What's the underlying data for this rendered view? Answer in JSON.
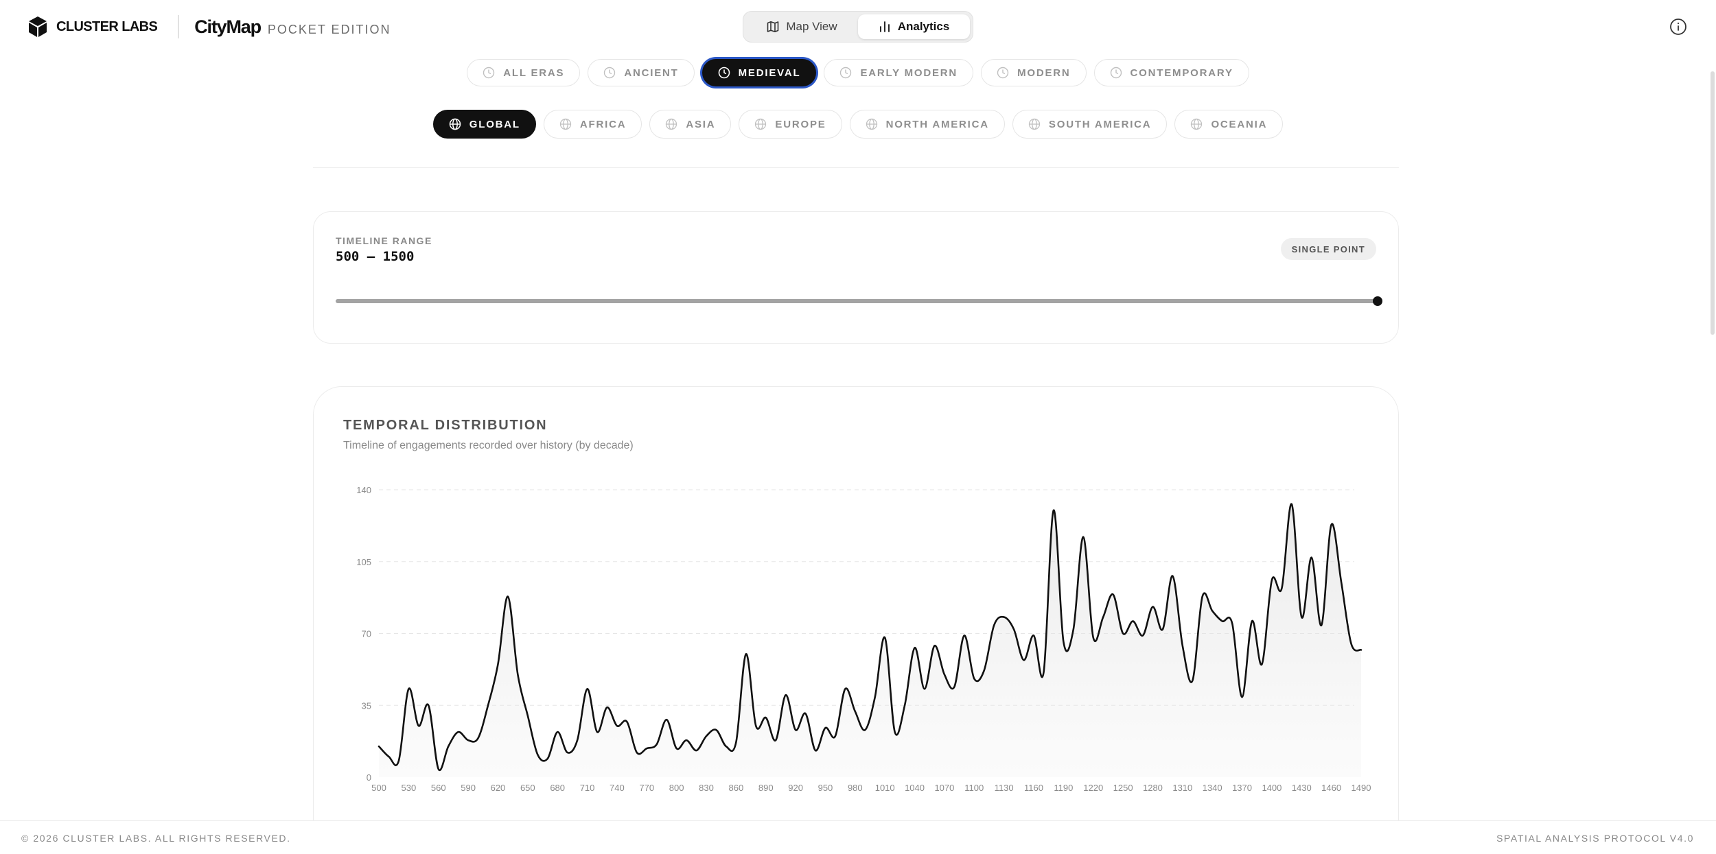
{
  "header": {
    "brand": "CLUSTER LABS",
    "app_name": "CityMap",
    "edition": "POCKET EDITION",
    "views": [
      {
        "label": "Map View",
        "icon": "map-icon",
        "active": false
      },
      {
        "label": "Analytics",
        "icon": "bar-chart-icon",
        "active": true
      }
    ],
    "info_icon": "info-icon"
  },
  "eras": [
    {
      "label": "ALL ERAS",
      "active": false
    },
    {
      "label": "ANCIENT",
      "active": false
    },
    {
      "label": "MEDIEVAL",
      "active": true
    },
    {
      "label": "EARLY MODERN",
      "active": false
    },
    {
      "label": "MODERN",
      "active": false
    },
    {
      "label": "CONTEMPORARY",
      "active": false
    }
  ],
  "regions": [
    {
      "label": "GLOBAL",
      "active": true
    },
    {
      "label": "AFRICA",
      "active": false
    },
    {
      "label": "ASIA",
      "active": false
    },
    {
      "label": "EUROPE",
      "active": false
    },
    {
      "label": "NORTH AMERICA",
      "active": false
    },
    {
      "label": "SOUTH AMERICA",
      "active": false
    },
    {
      "label": "OCEANIA",
      "active": false
    }
  ],
  "timeline": {
    "label": "TIMELINE RANGE",
    "value": "500 — 1500",
    "mode": "SINGLE POINT",
    "min": 500,
    "max": 1500,
    "selected": 1500
  },
  "chart": {
    "title": "TEMPORAL DISTRIBUTION",
    "subtitle": "Timeline of engagements recorded over history (by decade)"
  },
  "chart_data": {
    "type": "area",
    "title": "TEMPORAL DISTRIBUTION",
    "subtitle": "Timeline of engagements recorded over history (by decade)",
    "xlabel": "",
    "ylabel": "",
    "xlim": [
      500,
      1490
    ],
    "ylim": [
      0,
      140
    ],
    "yticks": [
      0,
      35,
      70,
      105,
      140
    ],
    "xtick_step": 30,
    "grid": true,
    "x": [
      500,
      510,
      520,
      530,
      540,
      550,
      560,
      570,
      580,
      590,
      600,
      610,
      620,
      630,
      640,
      650,
      660,
      670,
      680,
      690,
      700,
      710,
      720,
      730,
      740,
      750,
      760,
      770,
      780,
      790,
      800,
      810,
      820,
      830,
      840,
      850,
      860,
      870,
      880,
      890,
      900,
      910,
      920,
      930,
      940,
      950,
      960,
      970,
      980,
      990,
      1000,
      1010,
      1020,
      1030,
      1040,
      1050,
      1060,
      1070,
      1080,
      1090,
      1100,
      1110,
      1120,
      1130,
      1140,
      1150,
      1160,
      1170,
      1180,
      1190,
      1200,
      1210,
      1220,
      1230,
      1240,
      1250,
      1260,
      1270,
      1280,
      1290,
      1300,
      1310,
      1320,
      1330,
      1340,
      1350,
      1360,
      1370,
      1380,
      1390,
      1400,
      1410,
      1420,
      1430,
      1440,
      1450,
      1460,
      1470,
      1480,
      1490
    ],
    "series": [
      {
        "values": [
          15,
          10,
          8,
          43,
          25,
          35,
          4,
          15,
          22,
          18,
          19,
          35,
          55,
          88,
          50,
          30,
          11,
          9,
          22,
          12,
          18,
          43,
          22,
          34,
          25,
          27,
          12,
          14,
          16,
          28,
          14,
          18,
          13,
          20,
          23,
          15,
          17,
          60,
          25,
          29,
          18,
          40,
          23,
          31,
          13,
          24,
          20,
          43,
          32,
          23,
          39,
          68,
          22,
          35,
          63,
          43,
          64,
          50,
          44,
          69,
          48,
          52,
          74,
          78,
          72,
          57,
          69,
          51,
          130,
          66,
          72,
          117,
          68,
          78,
          89,
          70,
          76,
          69,
          83,
          72,
          98,
          64,
          47,
          88,
          81,
          76,
          75,
          39,
          76,
          55,
          96,
          92,
          133,
          78,
          107,
          74,
          123,
          95,
          65,
          62
        ]
      }
    ]
  },
  "footer": {
    "copyright": "© 2026 CLUSTER LABS. ALL RIGHTS RESERVED.",
    "protocol": "SPATIAL ANALYSIS PROTOCOL V4.0"
  },
  "colors": {
    "accent": "#111111",
    "focus_ring": "#2b57c6",
    "muted_text": "#8e8e8e",
    "line": "#111111"
  }
}
